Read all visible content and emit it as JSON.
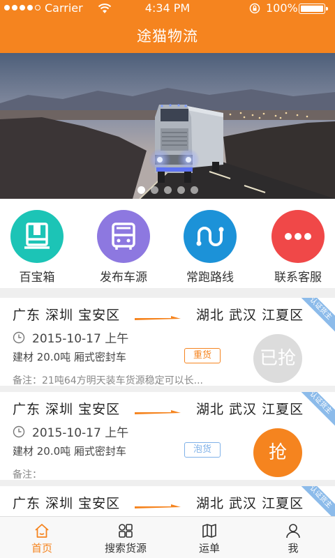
{
  "status_bar": {
    "carrier": "Carrier",
    "time": "4:34 PM",
    "battery": "100%"
  },
  "header": {
    "title": "途猫物流"
  },
  "banner": {
    "image": "truck-on-highway-photo",
    "page_count": 5,
    "active_page": 1
  },
  "quick_menu": [
    {
      "label": "百宝箱",
      "icon": "box-icon",
      "color": "#1cc4b6"
    },
    {
      "label": "发布车源",
      "icon": "bus-icon",
      "color": "#8d78e0"
    },
    {
      "label": "常跑路线",
      "icon": "route-icon",
      "color": "#1c92d8"
    },
    {
      "label": "联系客服",
      "icon": "more-icon",
      "color": "#f04848"
    }
  ],
  "listings": [
    {
      "from": "广东 深圳 宝安区",
      "to": "湖北 武汉 江夏区",
      "date": "2015-10-17 上午",
      "goods": "建材 20.0吨 厢式密封车",
      "tag": "重货",
      "note": "备注：21吨64方明天装车货源稳定可以长...",
      "action": "已抢",
      "ribbon": "认证货主"
    },
    {
      "from": "广东 深圳 宝安区",
      "to": "湖北 武汉 江夏区",
      "date": "2015-10-17 上午",
      "goods": "建材 20.0吨 厢式密封车",
      "tag": "泡货",
      "note": "备注：",
      "action": "抢",
      "ribbon": "认证货主"
    },
    {
      "from": "广东 深圳 宝安区",
      "to": "湖北 武汉 江夏区",
      "ribbon": "认证货主"
    }
  ],
  "tab_bar": [
    {
      "label": "首页",
      "icon": "home-icon",
      "active": true
    },
    {
      "label": "搜索货源",
      "icon": "grid-icon",
      "active": false
    },
    {
      "label": "运单",
      "icon": "map-icon",
      "active": false
    },
    {
      "label": "我",
      "icon": "person-icon",
      "active": false
    }
  ],
  "colors": {
    "accent": "#f5841f",
    "ribbon": "#8cbbea",
    "tag_light": "#7fb1e8"
  }
}
